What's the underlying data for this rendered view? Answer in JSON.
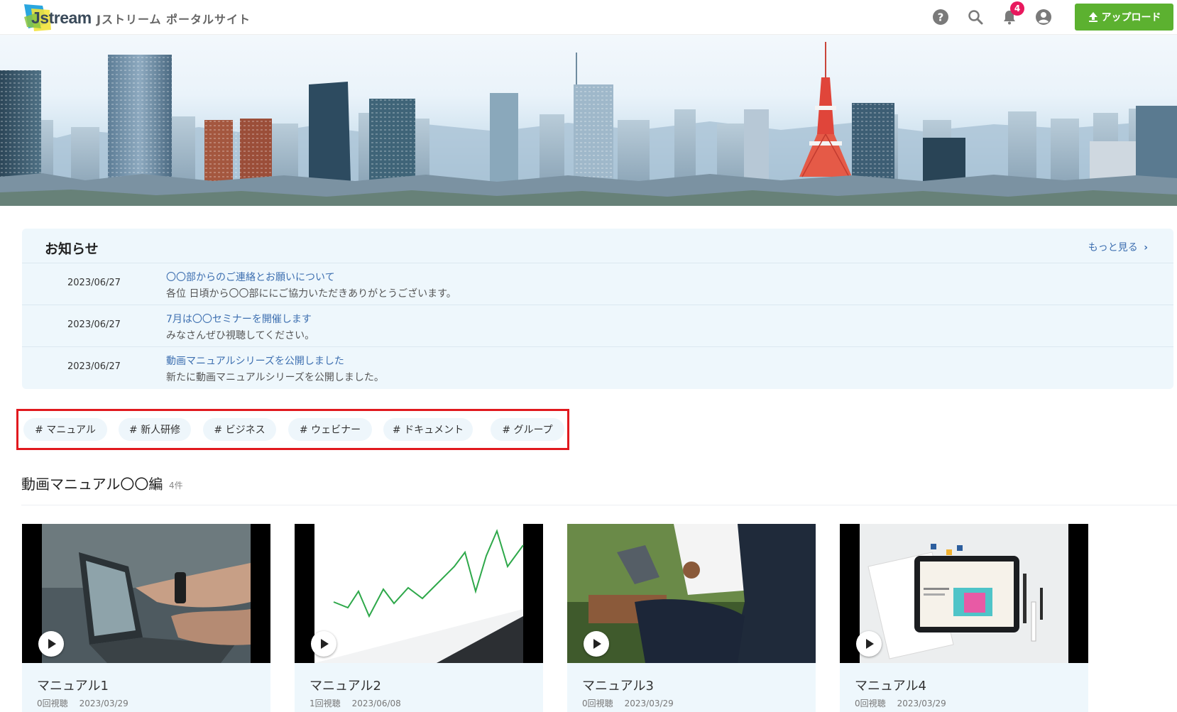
{
  "header": {
    "logo_text": "Jstream",
    "site_name": "Jストリーム ポータルサイト",
    "notification_count": "4",
    "upload_label": "アップロード",
    "icons": [
      "help-icon",
      "search-icon",
      "bell-icon",
      "account-icon",
      "upload-icon"
    ]
  },
  "news": {
    "title": "お知らせ",
    "more_label": "もっと見る",
    "items": [
      {
        "date": "2023/06/27",
        "title": "〇〇部からのご連絡とお願いについて",
        "desc": "各位 日頃から〇〇部ににご協力いただきありがとうございます。"
      },
      {
        "date": "2023/06/27",
        "title": "7月は〇〇セミナーを開催します",
        "desc": "みなさんぜひ視聴してください。"
      },
      {
        "date": "2023/06/27",
        "title": "動画マニュアルシリーズを公開しました",
        "desc": "新たに動画マニュアルシリーズを公開しました。"
      }
    ]
  },
  "tags": [
    "# マニュアル",
    "# 新人研修",
    "# ビジネス",
    "# ウェビナー",
    "# ドキュメント",
    "# グループ"
  ],
  "section": {
    "title": "動画マニュアル〇〇編",
    "count": "4件",
    "videos": [
      {
        "title": "マニュアル1",
        "views": "0回視聴",
        "date": "2023/03/29"
      },
      {
        "title": "マニュアル2",
        "views": "1回視聴",
        "date": "2023/06/08"
      },
      {
        "title": "マニュアル3",
        "views": "0回視聴",
        "date": "2023/03/29"
      },
      {
        "title": "マニュアル4",
        "views": "0回視聴",
        "date": "2023/03/29"
      }
    ]
  },
  "colors": {
    "accent_green": "#5cb130",
    "link_blue": "#3d6fb0",
    "badge_pink": "#e8185d",
    "highlight_red": "#e1191e",
    "panel_bg": "#eef7fc"
  }
}
